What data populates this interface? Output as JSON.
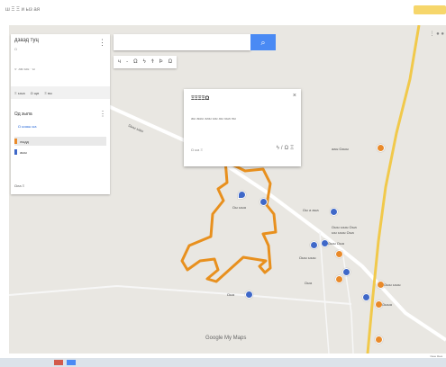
{
  "browser": {
    "tab_text": "ш  Ξ  Ξ и ыз ая",
    "right_chip": ""
  },
  "panel": {
    "title": "дзаэд туц",
    "subtitle": "Ω",
    "meta": "ч· ам ыы · ы",
    "actions": [
      "Ξ ыыа",
      "Ω щв",
      "Ξ вы"
    ],
    "layer_title": "Ωд зыла",
    "layer_style": "Ω ызаш ыа",
    "features": [
      {
        "label": "лыдд",
        "color": "#e98a2a",
        "selected": true
      },
      {
        "label": "аыы",
        "color": "#3f68c8",
        "selected": false
      }
    ],
    "basemap": "Ωла Ξ"
  },
  "search": {
    "placeholder": "",
    "button_icon": "search-icon"
  },
  "tools": [
    "ч",
    "-",
    "Ω",
    "ϟ",
    "Ϯ",
    "Ϸ",
    "Ω"
  ],
  "info": {
    "title": "ΞΞΞΞΩ",
    "description": "аы аыы ааы ыы аы зыа ны",
    "footer": "Ω ыа  Ξ",
    "icons": [
      "ϟ",
      "/",
      "Ω",
      "Ξ"
    ]
  },
  "labels": {
    "road": "Ωыы ыаы",
    "east1": "ааы Ωзыы",
    "mid1": "Ωы ыыа",
    "center1": "Ωы а аыа",
    "cluster1": "Ωыы ыыы Ωыа",
    "cluster2": "ыы ыыы Ωыа",
    "cluster3": "Ωыы Ωыа",
    "cluster4": "Ωыы ыыы",
    "lower1": "Ωыа",
    "lower2": "Ωыы ыыы",
    "lower3": "Ωыыа",
    "bottom": "Ωыа"
  },
  "brand": "Google My Maps",
  "attribution": "Ωыы Ωыа",
  "colors": {
    "route": "#e8901e",
    "accent": "#4a8af4",
    "marker_blue": "#3f68c8",
    "marker_orange": "#e98a2a",
    "road_yellow": "#f1c94b"
  }
}
